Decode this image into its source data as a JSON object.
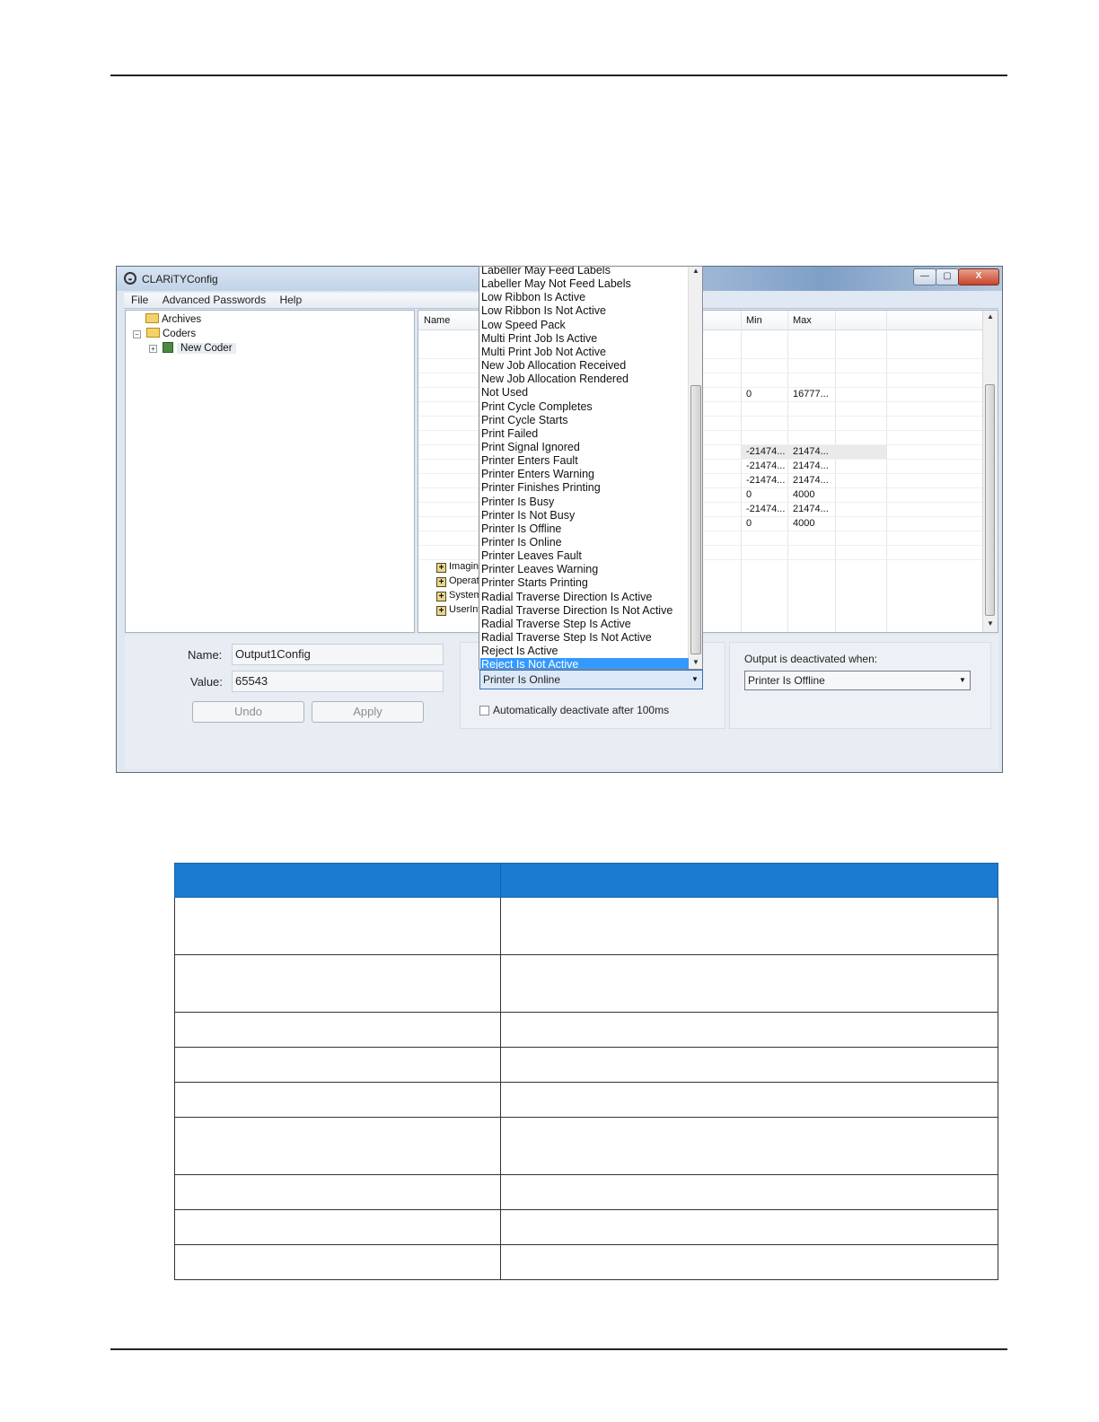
{
  "window": {
    "title": "CLARiTYConfig",
    "controls": {
      "minimize": "—",
      "maximize": "▢",
      "close": "X"
    }
  },
  "menu": [
    "File",
    "Advanced Passwords",
    "Help"
  ],
  "tree": {
    "archives": "Archives",
    "coders": "Coders",
    "new_coder": "New Coder"
  },
  "grid": {
    "columns": {
      "name": "Name",
      "min": "Min",
      "max": "Max"
    },
    "rows": [
      {
        "min": "0",
        "max": "16777..."
      },
      {
        "min": "-21474...",
        "max": "21474..."
      },
      {
        "min": "-21474...",
        "max": "21474..."
      },
      {
        "min": "-21474...",
        "max": "21474..."
      },
      {
        "min": "0",
        "max": "4000"
      },
      {
        "min": "-21474...",
        "max": "21474..."
      },
      {
        "min": "0",
        "max": "4000"
      }
    ],
    "subnodes": [
      "Imaging",
      "Operati",
      "System",
      "UserInt"
    ]
  },
  "config": {
    "name_label": "Name:",
    "name_value": "Output1Config",
    "value_label": "Value:",
    "value_value": "65543",
    "undo_label": "Undo",
    "apply_label": "Apply",
    "activated_selected": "Printer Is Online",
    "auto_deactivate_label": "Automatically deactivate after 100ms",
    "auto_deactivate_checked": false,
    "deactivated_label": "Output is deactivated when:",
    "deactivated_selected": "Printer Is Offline"
  },
  "dropdown": {
    "selected_index": 29,
    "items": [
      "Labeller May Feed Labels",
      "Labeller May Not Feed Labels",
      "Low Ribbon Is Active",
      "Low Ribbon Is Not Active",
      "Low Speed Pack",
      "Multi Print Job Is Active",
      "Multi Print Job Not Active",
      "New Job Allocation Received",
      "New Job Allocation Rendered",
      "Not Used",
      "Print Cycle Completes",
      "Print Cycle Starts",
      "Print Failed",
      "Print Signal Ignored",
      "Printer Enters Fault",
      "Printer Enters Warning",
      "Printer Finishes Printing",
      "Printer Is Busy",
      "Printer Is Not Busy",
      "Printer Is Offline",
      "Printer Is Online",
      "Printer Leaves Fault",
      "Printer Leaves Warning",
      "Printer Starts Printing",
      "Radial Traverse Direction Is Active",
      "Radial Traverse Direction Is Not Active",
      "Radial Traverse Step Is Active",
      "Radial Traverse Step Is Not Active",
      "Reject Is Active",
      "Reject Is Not Active"
    ]
  },
  "colors": {
    "table_header": "#1a7bd1",
    "selection": "#3399ff"
  }
}
